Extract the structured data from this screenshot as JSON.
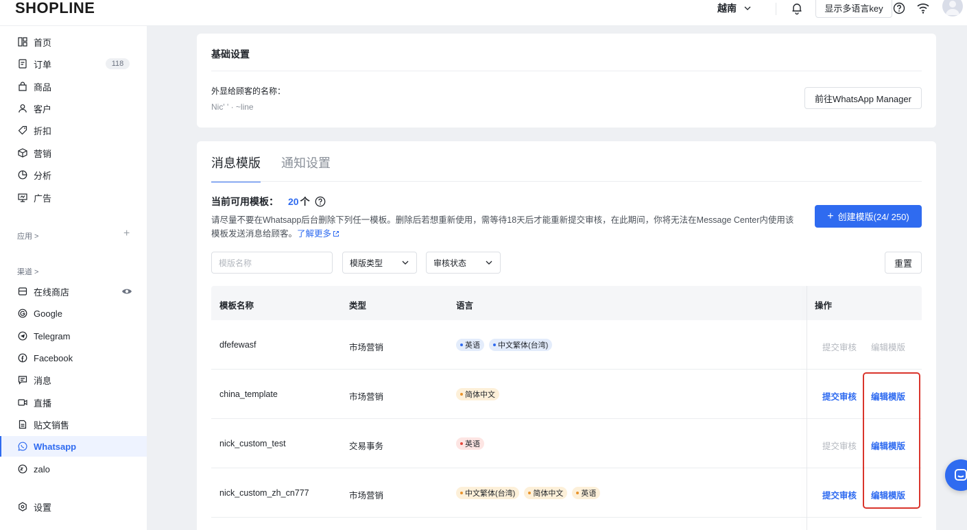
{
  "app": {
    "logo": "SHOPLINE"
  },
  "topbar": {
    "region": "越南",
    "lang_button": "显示多语言key"
  },
  "sidebar": {
    "items": [
      {
        "label": "首页",
        "icon": "dashboard-icon"
      },
      {
        "label": "订单",
        "icon": "order-icon",
        "badge": "118"
      },
      {
        "label": "商品",
        "icon": "bag-icon"
      },
      {
        "label": "客户",
        "icon": "user-icon"
      },
      {
        "label": "折扣",
        "icon": "tag-icon"
      },
      {
        "label": "营销",
        "icon": "cube-icon"
      },
      {
        "label": "分析",
        "icon": "pie-icon"
      },
      {
        "label": "广告",
        "icon": "ad-icon"
      }
    ],
    "apps_label": "应用 >",
    "channels_label": "渠道 >",
    "channels": [
      {
        "label": "在线商店",
        "icon": "store-icon"
      },
      {
        "label": "Google",
        "icon": "google-icon"
      },
      {
        "label": "Telegram",
        "icon": "telegram-icon"
      },
      {
        "label": "Facebook",
        "icon": "facebook-icon"
      },
      {
        "label": "消息",
        "icon": "message-icon"
      },
      {
        "label": "直播",
        "icon": "video-icon"
      },
      {
        "label": "贴文销售",
        "icon": "post-icon"
      },
      {
        "label": "Whatsapp",
        "icon": "whatsapp-icon",
        "active": true
      },
      {
        "label": "zalo",
        "icon": "zalo-icon"
      }
    ],
    "settings_label": "设置"
  },
  "basic": {
    "title": "基础设置",
    "display_name_label": "外显给顾客的名称：",
    "display_name_value": "Nic'  ' ·  ~line",
    "manager_button": "前往WhatsApp Manager"
  },
  "templates": {
    "tabs": [
      "消息模版",
      "通知设置"
    ],
    "available_label": "当前可用模板：",
    "available_count": "20",
    "available_unit": "个",
    "notice": "请尽量不要在Whatsapp后台删除下列任一模板。删除后若想重新使用，需等待18天后才能重新提交审核，在此期间，你将无法在Message Center内使用该模板发送消息给顾客。",
    "learn_more": "了解更多",
    "create_button": "创建模版(24/ 250)",
    "filters": {
      "name_placeholder": "模版名称",
      "type_label": "模版类型",
      "status_label": "审核状态",
      "reset_button": "重置"
    },
    "columns": [
      "模板名称",
      "类型",
      "语言",
      "操作"
    ],
    "rows": [
      {
        "name": "dfefewasf",
        "type": "市场营销",
        "langs": [
          {
            "label": "英语",
            "color": "blue"
          },
          {
            "label": "中文繁体(台湾)",
            "color": "blue"
          }
        ],
        "submit": "提交审核",
        "submit_enabled": false,
        "edit": "编辑模版",
        "edit_enabled": false
      },
      {
        "name": "china_template",
        "type": "市场营销",
        "langs": [
          {
            "label": "简体中文",
            "color": "orange"
          }
        ],
        "submit": "提交审核",
        "submit_enabled": true,
        "edit": "编辑模版",
        "edit_enabled": true
      },
      {
        "name": "nick_custom_test",
        "type": "交易事务",
        "langs": [
          {
            "label": "英语",
            "color": "red"
          }
        ],
        "submit": "提交审核",
        "submit_enabled": false,
        "edit": "编辑模版",
        "edit_enabled": true
      },
      {
        "name": "nick_custom_zh_cn777",
        "type": "市场营销",
        "langs": [
          {
            "label": "中文繁体(台湾)",
            "color": "orange"
          },
          {
            "label": "简体中文",
            "color": "orange"
          },
          {
            "label": "英语",
            "color": "orange"
          }
        ],
        "submit": "提交审核",
        "submit_enabled": true,
        "edit": "编辑模版",
        "edit_enabled": true
      }
    ]
  },
  "colors": {
    "primary": "#2f6bf0",
    "highlight": "#d9342b"
  }
}
